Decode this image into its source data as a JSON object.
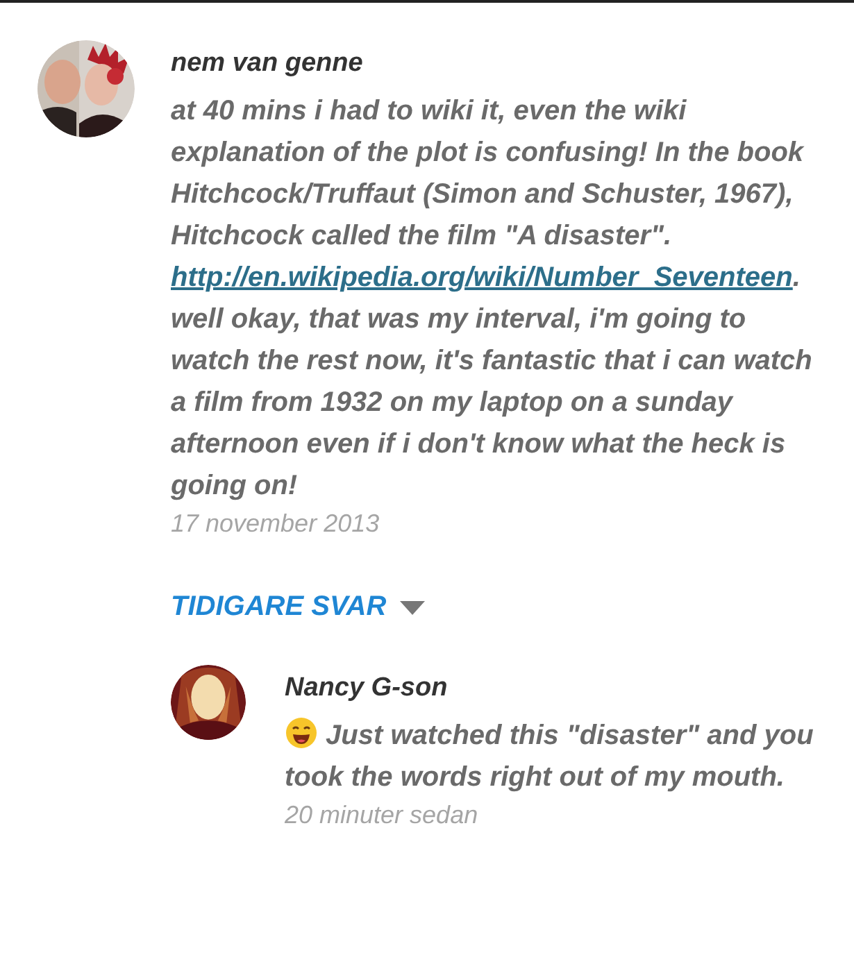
{
  "comments": [
    {
      "author": "nem van genne",
      "avatar": {
        "kind": "picture"
      },
      "body": [
        {
          "kind": "text",
          "text": "at 40 mins i had to wiki it, even the wiki explanation of the plot is confusing! In the book Hitchcock/Truffaut (Simon and Schuster, 1967), Hitchcock called the film \"A disaster\". "
        },
        {
          "kind": "link",
          "text": "http://en.wikipedia.org/wiki/Number_Seventeen"
        },
        {
          "kind": "text",
          "text": ". well okay, that was my interval, i'm going to watch the rest now, it's fantastic that i can watch a film from 1932 on my laptop on a sunday afternoon even if i don't know what the heck is going on!"
        }
      ],
      "date": "17 november 2013",
      "replies_toggle": {
        "label": "TIDIGARE SVAR",
        "expanded": true
      },
      "replies": [
        {
          "author": "Nancy G-son",
          "avatar": {
            "kind": "picture"
          },
          "body": [
            {
              "kind": "emoji"
            },
            {
              "kind": "text",
              "text": " Just watched this \"disaster\" and you took the words right out of my mouth."
            }
          ],
          "date": "20 minuter sedan"
        }
      ]
    }
  ]
}
